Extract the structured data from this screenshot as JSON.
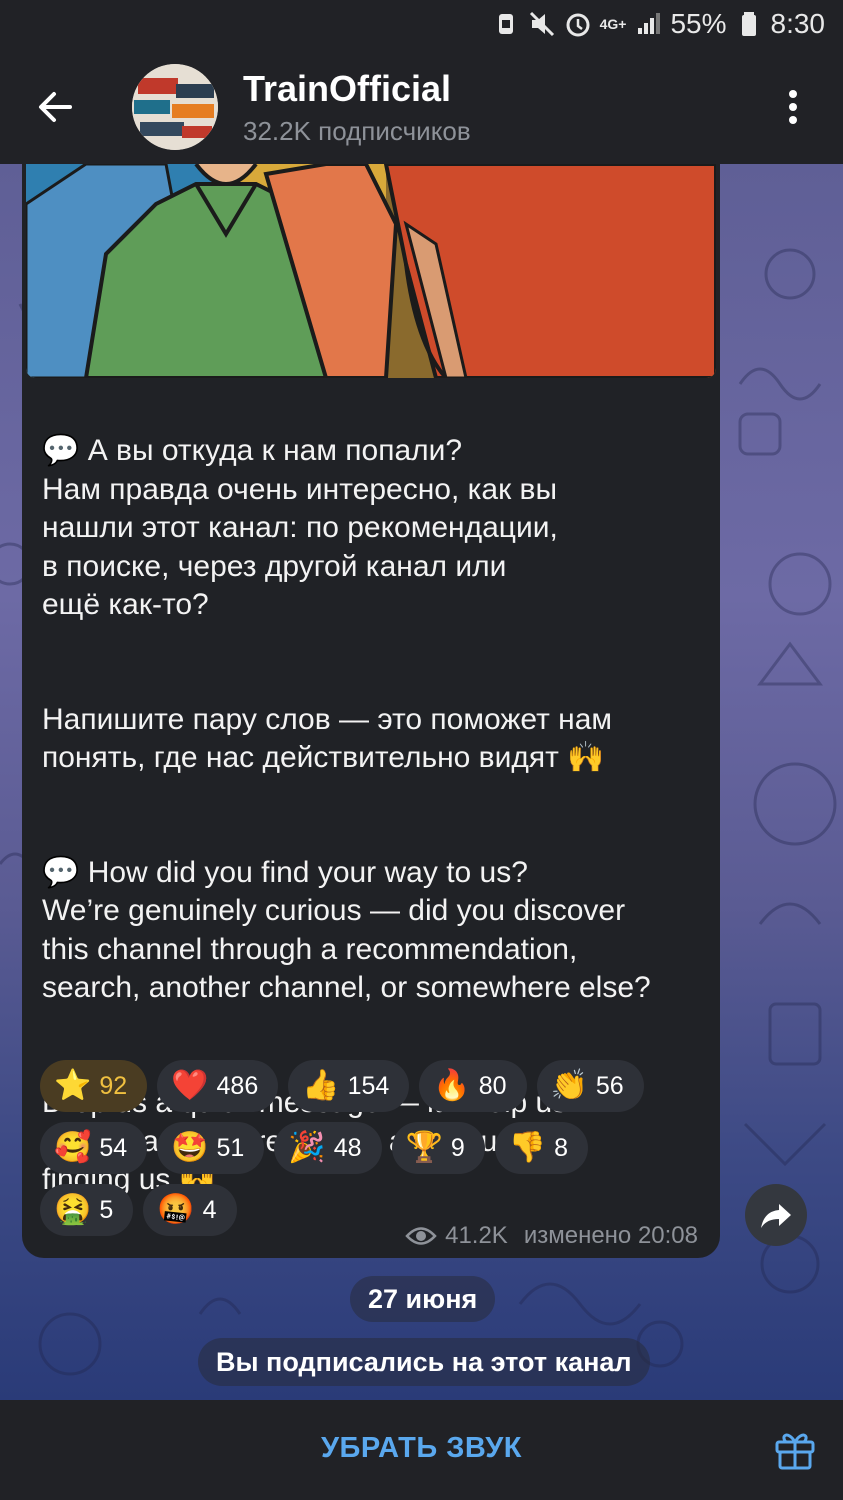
{
  "status_bar": {
    "battery": "55%",
    "time": "8:30",
    "network": "4G+"
  },
  "header": {
    "channel_name": "TrainOfficial",
    "subscribers": "32.2K подписчиков"
  },
  "message": {
    "paragraphs": [
      "💬 А вы откуда к нам попали?\nНам правда очень интересно, как вы\nнашли этот канал: по рекомендации,\nв поиске, через другой канал или\nещё как-то?",
      "Напишите пару слов — это поможет нам\nпонять, где нас действительно видят 🙌",
      "💬 How did you find your way to us?\nWe’re genuinely curious — did you discover\nthis channel through a recommendation,\nsearch, another channel, or somewhere else?",
      "Drop us a quick message — it’ll help us\nunderstand where people are actually\nfinding us 🙌"
    ],
    "reactions": [
      [
        {
          "emoji": "⭐",
          "count": "92",
          "active": true
        },
        {
          "emoji": "❤️",
          "count": "486"
        },
        {
          "emoji": "👍",
          "count": "154"
        },
        {
          "emoji": "🔥",
          "count": "80"
        },
        {
          "emoji": "👏",
          "count": "56"
        }
      ],
      [
        {
          "emoji": "🥰",
          "count": "54"
        },
        {
          "emoji": "🤩",
          "count": "51"
        },
        {
          "emoji": "🎉",
          "count": "48"
        },
        {
          "emoji": "🏆",
          "count": "9"
        },
        {
          "emoji": "👎",
          "count": "8"
        }
      ],
      [
        {
          "emoji": "🤮",
          "count": "5"
        },
        {
          "emoji": "🤬",
          "count": "4"
        }
      ]
    ],
    "views": "41.2K",
    "edited": "изменено 20:08"
  },
  "service": {
    "date": "27 июня",
    "subscribed": "Вы подписались на этот канал"
  },
  "bottom": {
    "mute_label": "УБРАТЬ ЗВУК"
  },
  "colors": {
    "accent": "#5aa8ee",
    "bubble": "#202226",
    "header": "#212226",
    "active_reaction": "#f0c040"
  }
}
